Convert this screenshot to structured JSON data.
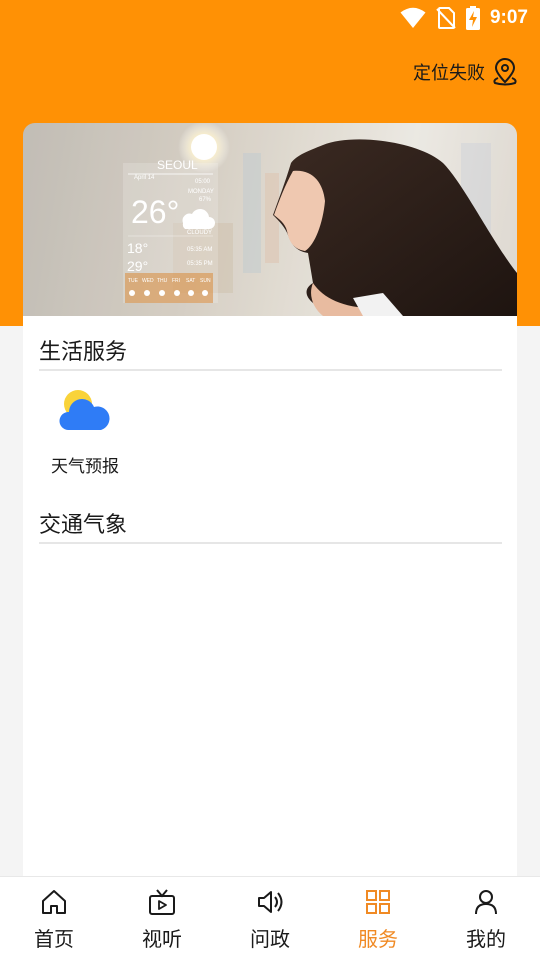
{
  "status_bar": {
    "time": "9:07",
    "icons": [
      "wifi-icon",
      "no-sim-icon",
      "battery-charging-icon"
    ]
  },
  "header": {
    "location_text": "定位失败",
    "location_icon": "location-pin-icon"
  },
  "banner": {
    "weather_widget": {
      "city": "SEOUL",
      "date": "April 14",
      "time": "05:00",
      "day": "MONDAY",
      "humidity": "67%",
      "temperature": "26°",
      "condition": "CLOUDY",
      "low": "18°",
      "high": "29°",
      "sunrise": "05:35 AM",
      "sunset": "05:35 PM",
      "forecast_days": [
        "TUE",
        "WED",
        "THU",
        "FRI",
        "SAT",
        "SUN"
      ]
    }
  },
  "sections": [
    {
      "title": "生活服务",
      "items": [
        {
          "label": "天气预报",
          "icon": "weather-partly-cloudy-icon"
        }
      ]
    },
    {
      "title": "交通气象",
      "items": []
    }
  ],
  "tabbar": {
    "tabs": [
      {
        "label": "首页",
        "icon": "home-icon",
        "active": false
      },
      {
        "label": "视听",
        "icon": "tv-icon",
        "active": false
      },
      {
        "label": "问政",
        "icon": "speaker-icon",
        "active": false
      },
      {
        "label": "服务",
        "icon": "grid-icon",
        "active": true
      },
      {
        "label": "我的",
        "icon": "user-icon",
        "active": false
      }
    ]
  },
  "colors": {
    "brand": "#ff9105",
    "active_tab": "#f08a24"
  }
}
